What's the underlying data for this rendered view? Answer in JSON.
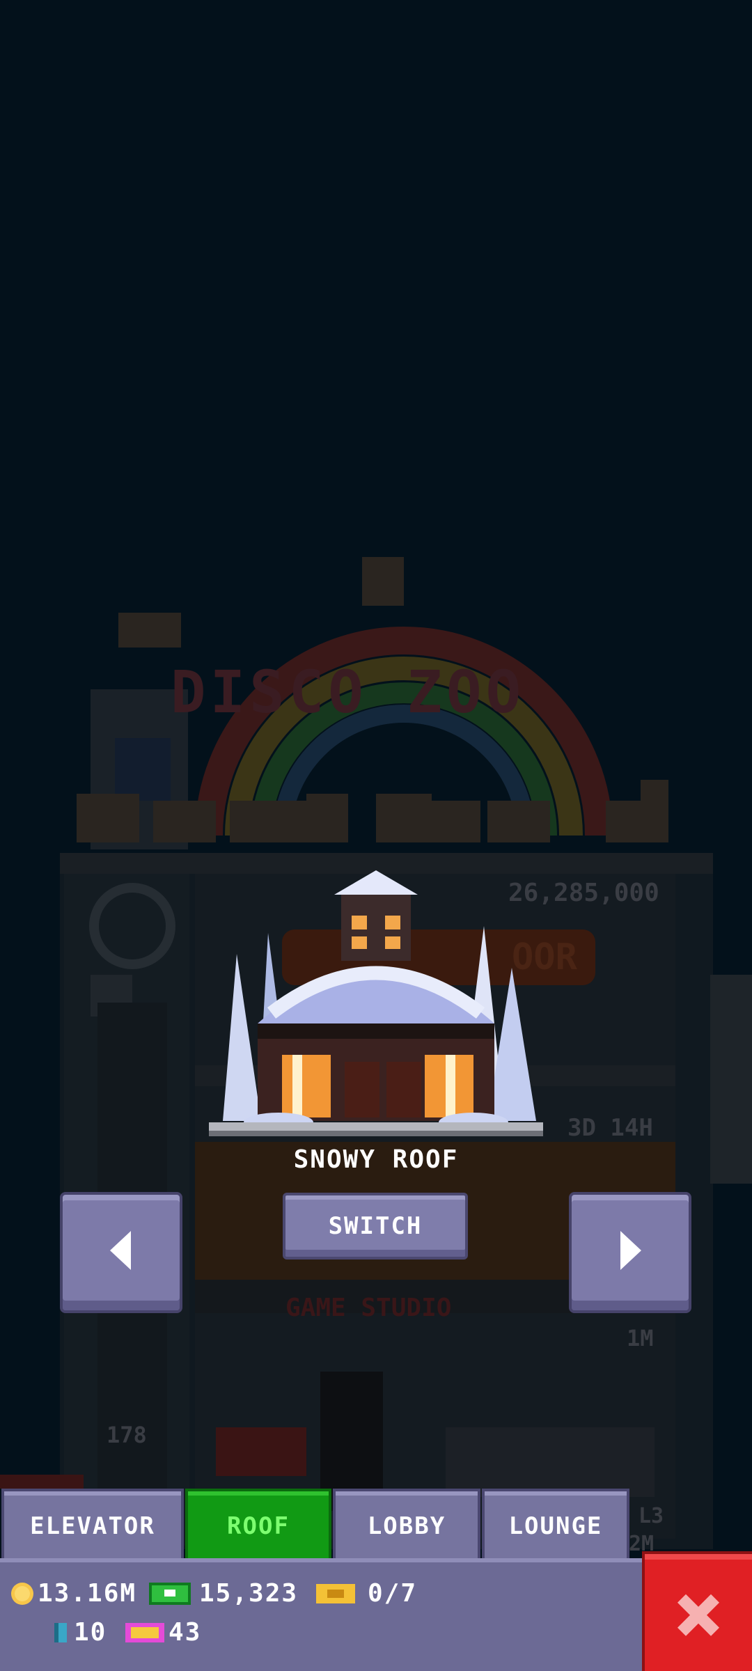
{
  "preview": {
    "roof_name": "SNOWY ROOF",
    "switch_label": "SWITCH",
    "prev_icon": "arrow-left-icon",
    "next_icon": "arrow-right-icon"
  },
  "background_tower": {
    "zoo_sign": "DISCO ZOO",
    "price": "26,285,000",
    "floor_sign": "OOR",
    "timer": "3D 14H",
    "floor_name": "GAME STUDIO",
    "floor_value": "1M",
    "floor_number": "178",
    "side_label_1": "L3",
    "side_label_2": "2M"
  },
  "tabs": [
    {
      "label": "ELEVATOR",
      "active": false
    },
    {
      "label": "ROOF",
      "active": true
    },
    {
      "label": "LOBBY",
      "active": false
    },
    {
      "label": "LOUNGE",
      "active": false
    }
  ],
  "currencies": {
    "coins": "13.16M",
    "bux": "15,323",
    "tickets": "0/7",
    "keys": "10",
    "vip": "43"
  },
  "close_icon": "close-icon",
  "colors": {
    "background": "#03111b",
    "button": "#7d7aa9",
    "active_tab": "#119a14",
    "close": "#e02024"
  }
}
